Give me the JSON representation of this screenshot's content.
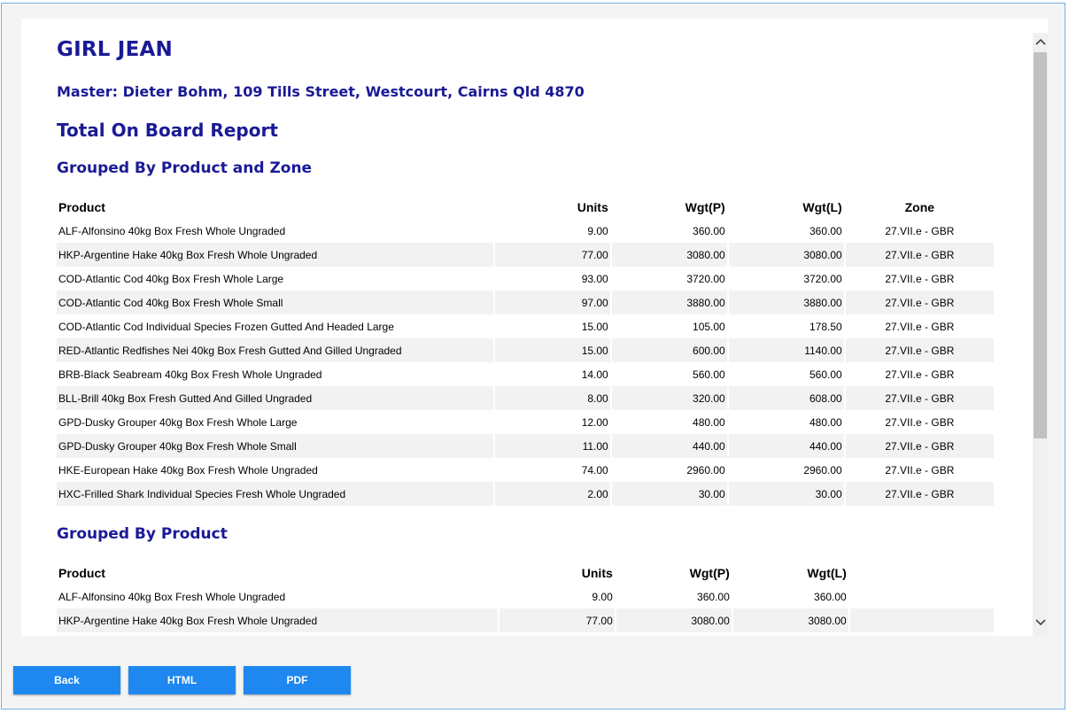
{
  "report": {
    "vessel_name": "GIRL JEAN",
    "master_line": "Master: Dieter Bohm, 109 Tills Street, Westcourt, Cairns Qld 4870",
    "title": "Total On Board Report"
  },
  "product_zone": {
    "title": "Grouped By Product and Zone",
    "headers": {
      "product": "Product",
      "units": "Units",
      "wgt_p": "Wgt(P)",
      "wgt_l": "Wgt(L)",
      "zone": "Zone"
    },
    "rows": [
      {
        "product": "ALF-Alfonsino 40kg Box Fresh Whole Ungraded",
        "units": "9.00",
        "wgt_p": "360.00",
        "wgt_l": "360.00",
        "zone": "27.VII.e - GBR"
      },
      {
        "product": "HKP-Argentine Hake 40kg Box Fresh Whole Ungraded",
        "units": "77.00",
        "wgt_p": "3080.00",
        "wgt_l": "3080.00",
        "zone": "27.VII.e - GBR"
      },
      {
        "product": "COD-Atlantic Cod 40kg Box Fresh Whole Large",
        "units": "93.00",
        "wgt_p": "3720.00",
        "wgt_l": "3720.00",
        "zone": "27.VII.e - GBR"
      },
      {
        "product": "COD-Atlantic Cod 40kg Box Fresh Whole Small",
        "units": "97.00",
        "wgt_p": "3880.00",
        "wgt_l": "3880.00",
        "zone": "27.VII.e - GBR"
      },
      {
        "product": "COD-Atlantic Cod Individual Species Frozen Gutted And Headed Large",
        "units": "15.00",
        "wgt_p": "105.00",
        "wgt_l": "178.50",
        "zone": "27.VII.e - GBR"
      },
      {
        "product": "RED-Atlantic Redfishes Nei 40kg Box Fresh Gutted And Gilled Ungraded",
        "units": "15.00",
        "wgt_p": "600.00",
        "wgt_l": "1140.00",
        "zone": "27.VII.e - GBR"
      },
      {
        "product": "BRB-Black Seabream 40kg Box Fresh Whole Ungraded",
        "units": "14.00",
        "wgt_p": "560.00",
        "wgt_l": "560.00",
        "zone": "27.VII.e - GBR"
      },
      {
        "product": "BLL-Brill 40kg Box Fresh Gutted And Gilled Ungraded",
        "units": "8.00",
        "wgt_p": "320.00",
        "wgt_l": "608.00",
        "zone": "27.VII.e - GBR"
      },
      {
        "product": "GPD-Dusky Grouper 40kg Box Fresh Whole Large",
        "units": "12.00",
        "wgt_p": "480.00",
        "wgt_l": "480.00",
        "zone": "27.VII.e - GBR"
      },
      {
        "product": "GPD-Dusky Grouper 40kg Box Fresh Whole Small",
        "units": "11.00",
        "wgt_p": "440.00",
        "wgt_l": "440.00",
        "zone": "27.VII.e - GBR"
      },
      {
        "product": "HKE-European Hake 40kg Box Fresh Whole Ungraded",
        "units": "74.00",
        "wgt_p": "2960.00",
        "wgt_l": "2960.00",
        "zone": "27.VII.e - GBR"
      },
      {
        "product": "HXC-Frilled Shark Individual Species Fresh Whole Ungraded",
        "units": "2.00",
        "wgt_p": "30.00",
        "wgt_l": "30.00",
        "zone": "27.VII.e - GBR"
      }
    ]
  },
  "product_only": {
    "title": "Grouped By Product",
    "headers": {
      "product": "Product",
      "units": "Units",
      "wgt_p": "Wgt(P)",
      "wgt_l": "Wgt(L)"
    },
    "rows": [
      {
        "product": "ALF-Alfonsino 40kg Box Fresh Whole Ungraded",
        "units": "9.00",
        "wgt_p": "360.00",
        "wgt_l": "360.00"
      },
      {
        "product": "HKP-Argentine Hake 40kg Box Fresh Whole Ungraded",
        "units": "77.00",
        "wgt_p": "3080.00",
        "wgt_l": "3080.00"
      }
    ]
  },
  "buttons": {
    "back": "Back",
    "html": "HTML",
    "pdf": "PDF"
  },
  "icons": {
    "scroll_up": "chevron-up-icon",
    "scroll_down": "chevron-down-icon"
  },
  "colors": {
    "heading": "#1a1a96",
    "button": "#1e88f0",
    "row_alt": "#f2f2f2"
  }
}
